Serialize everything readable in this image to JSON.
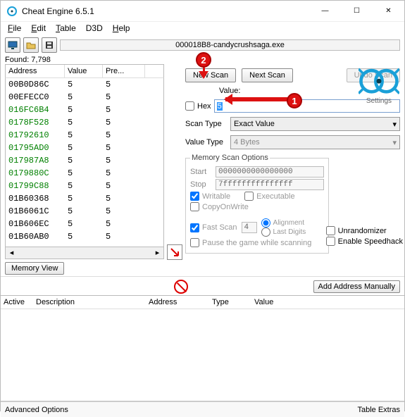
{
  "window": {
    "title": "Cheat Engine 6.5.1",
    "minimize": "—",
    "maximize": "☐",
    "close": "✕"
  },
  "menu": {
    "file": "File",
    "edit": "Edit",
    "table": "Table",
    "d3d": "D3D",
    "help": "Help"
  },
  "process_label": "000018B8-candycrushsaga.exe",
  "found_label": "Found: 7,798",
  "columns": {
    "address": "Address",
    "value": "Value",
    "previous": "Pre..."
  },
  "rows": [
    {
      "addr": "00B0D86C",
      "val": "5",
      "prev": "5",
      "changed": false
    },
    {
      "addr": "00EFECC0",
      "val": "5",
      "prev": "5",
      "changed": false
    },
    {
      "addr": "016FC6B4",
      "val": "5",
      "prev": "5",
      "changed": true
    },
    {
      "addr": "0178F528",
      "val": "5",
      "prev": "5",
      "changed": true
    },
    {
      "addr": "01792610",
      "val": "5",
      "prev": "5",
      "changed": true
    },
    {
      "addr": "01795AD0",
      "val": "5",
      "prev": "5",
      "changed": true
    },
    {
      "addr": "017987A8",
      "val": "5",
      "prev": "5",
      "changed": true
    },
    {
      "addr": "0179880C",
      "val": "5",
      "prev": "5",
      "changed": true
    },
    {
      "addr": "01799C88",
      "val": "5",
      "prev": "5",
      "changed": true
    },
    {
      "addr": "01B60368",
      "val": "5",
      "prev": "5",
      "changed": false
    },
    {
      "addr": "01B6061C",
      "val": "5",
      "prev": "5",
      "changed": false
    },
    {
      "addr": "01B606EC",
      "val": "5",
      "prev": "5",
      "changed": false
    },
    {
      "addr": "01B60AB0",
      "val": "5",
      "prev": "5",
      "changed": false
    }
  ],
  "memory_view": "Memory View",
  "scan": {
    "new": "New Scan",
    "next": "Next Scan",
    "undo": "Undo Scan",
    "value_label": "Value:",
    "hex_label": "Hex",
    "value": "5",
    "scan_type_label": "Scan Type",
    "scan_type": "Exact Value",
    "value_type_label": "Value Type",
    "value_type": "4 Bytes"
  },
  "mso": {
    "legend": "Memory Scan Options",
    "start_label": "Start",
    "start": "0000000000000000",
    "stop_label": "Stop",
    "stop": "7fffffffffffffff",
    "writable": "Writable",
    "executable": "Executable",
    "copyonwrite": "CopyOnWrite",
    "fastscan": "Fast Scan",
    "fastscan_val": "4",
    "alignment": "Alignment",
    "lastdigits": "Last Digits",
    "pause": "Pause the game while scanning"
  },
  "side": {
    "unrandomizer": "Unrandomizer",
    "speedhack": "Enable Speedhack"
  },
  "settings_label": "Settings",
  "add_manual": "Add Address Manually",
  "cheat_cols": {
    "active": "Active",
    "description": "Description",
    "address": "Address",
    "type": "Type",
    "value": "Value"
  },
  "status": {
    "left": "Advanced Options",
    "right": "Table Extras"
  },
  "annotations": {
    "one": "1",
    "two": "2"
  }
}
